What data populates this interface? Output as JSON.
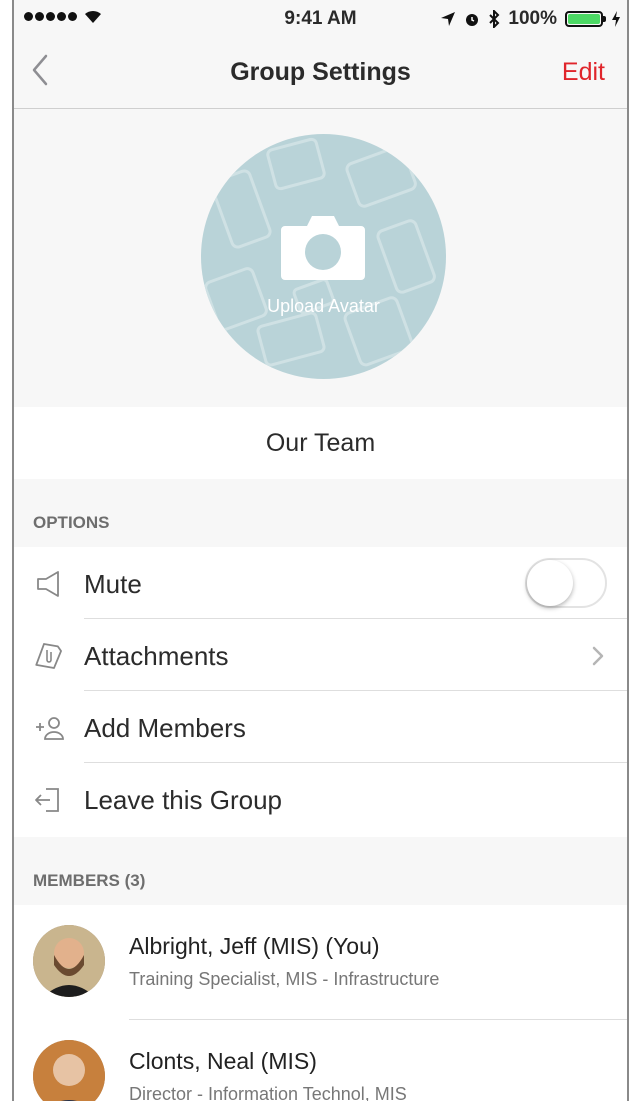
{
  "status_bar": {
    "time": "9:41 AM",
    "battery_percent": "100%",
    "battery_level": 1.0,
    "signal_bars": 5
  },
  "nav": {
    "title": "Group Settings",
    "edit_label": "Edit",
    "back_icon": "chevron-left-icon",
    "accent_color": "#e0252b"
  },
  "avatar": {
    "upload_label": "Upload Avatar",
    "icon": "camera-icon",
    "background_color": "#b9d3d8"
  },
  "group": {
    "name": "Our Team"
  },
  "options": {
    "header": "OPTIONS",
    "items": [
      {
        "label": "Mute",
        "icon": "speaker-icon",
        "control": "toggle",
        "toggle_on": false
      },
      {
        "label": "Attachments",
        "icon": "paperclip-icon",
        "control": "chevron"
      },
      {
        "label": "Add Members",
        "icon": "add-person-icon",
        "control": "none"
      },
      {
        "label": "Leave this Group",
        "icon": "exit-icon",
        "control": "none"
      }
    ]
  },
  "members": {
    "header": "MEMBERS (3)",
    "items": [
      {
        "name": "Albright, Jeff (MIS) (You)",
        "title": "Training Specialist, MIS - Infrastructure"
      },
      {
        "name": "Clonts, Neal (MIS)",
        "title": "Director - Information Technol, MIS"
      }
    ]
  }
}
